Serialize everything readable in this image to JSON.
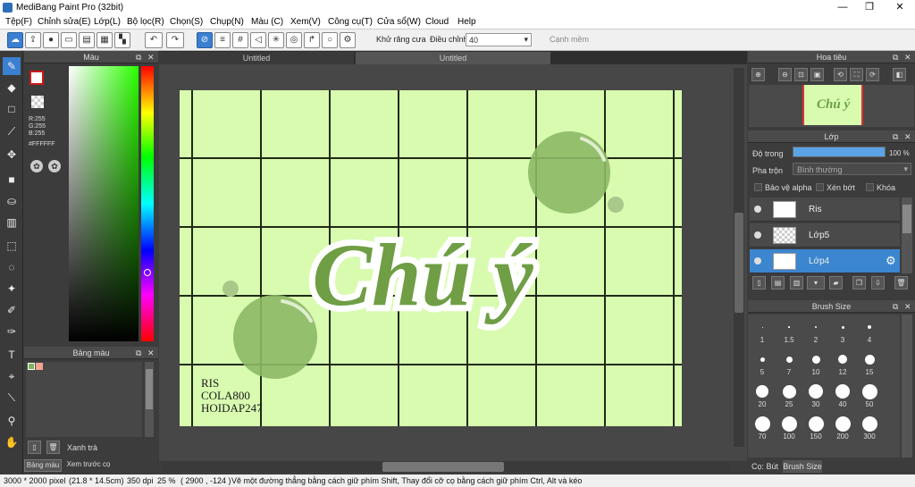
{
  "window": {
    "title": "MediBang Paint Pro (32bit)"
  },
  "menu": [
    "Tệp(F)",
    "Chỉnh sửa(E)",
    "Lớp(L)",
    "Bộ lọc(R)",
    "Chọn(S)",
    "Chụp(N)",
    "Màu (C)",
    "Xem(V)",
    "Công cụ(T)",
    "Cửa sổ(W)",
    "Cloud",
    "Help"
  ],
  "toolbar": {
    "antialias_label": "Khử răng cưa",
    "correction_label": "Điều chỉnh",
    "correction_value": "40",
    "edge_label": "Cạnh mềm"
  },
  "color_panel": {
    "title": "Màu",
    "r": "R:255",
    "g": "G:255",
    "b": "B:255",
    "hex": "#FFFFFF"
  },
  "palette_panel": {
    "title": "Bảng màu",
    "color_name": "Xanh trà"
  },
  "bottom_tabs": {
    "palette": "Bảng màu",
    "brush_preview": "Xem trước cọ"
  },
  "doc_tabs": [
    "Untitled",
    "Untitled"
  ],
  "canvas": {
    "main_text": "Chú ý",
    "credits": [
      "RIS",
      "COLA800",
      "HOIDAP247"
    ]
  },
  "navigator": {
    "title": "Hoa tiêu"
  },
  "layer_panel": {
    "title": "Lớp",
    "opacity_label": "Độ trong",
    "opacity_value": "100 %",
    "opacity_fraction": 1.0,
    "blend_label": "Pha trộn",
    "blend_value": "Bình thường",
    "protect_alpha": "Bảo vệ alpha",
    "clipping": "Xén bớt",
    "lock": "Khóa",
    "layers": [
      {
        "name": "Ris",
        "selected": false
      },
      {
        "name": "Lớp5",
        "selected": false
      },
      {
        "name": "Lớp4",
        "selected": true
      }
    ]
  },
  "brush_size_panel": {
    "title": "Brush Size",
    "sizes": [
      "1",
      "1.5",
      "2",
      "3",
      "4",
      "5",
      "7",
      "10",
      "12",
      "15",
      "20",
      "25",
      "30",
      "40",
      "50",
      "70",
      "100",
      "150",
      "200",
      "300"
    ]
  },
  "right_bottom_tabs": {
    "brush": "Cọ: Bút",
    "brush_size": "Brush Size"
  },
  "status": {
    "size": "3000 * 2000 pixel",
    "cm": "(21.8 * 14.5cm)",
    "dpi": "350 dpi",
    "zoom": "25 %",
    "coords": "( 2900 , -124 )",
    "hint": "Vẽ một đường thẳng bằng cách giữ phím Shift, Thay đổi cỡ cọ bằng cách giữ phím Ctrl, Alt và kéo"
  },
  "colors": {
    "canvas_bg": "#d8fbb0",
    "text_green": "#6f9e45",
    "accent": "#3b86cf",
    "bubble": "#8db866"
  }
}
